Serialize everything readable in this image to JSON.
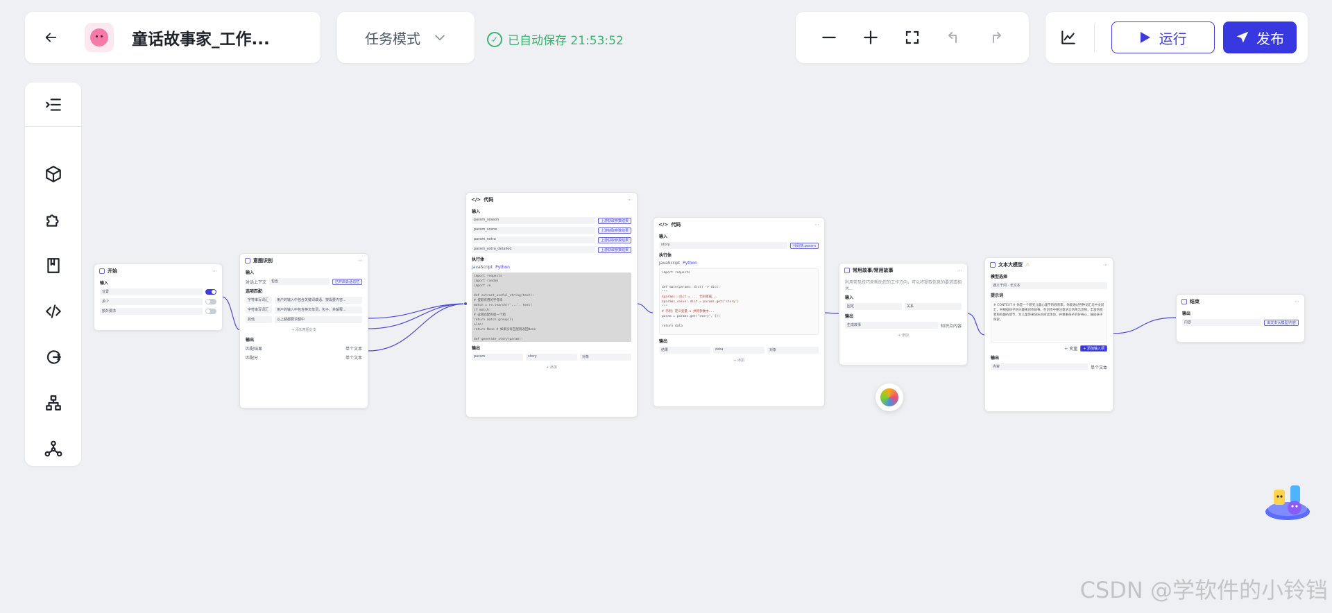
{
  "header": {
    "app_title": "童话故事家_工作...",
    "mode_label": "任务模式",
    "autosave_text": "已自动保存 21:53:52",
    "run_label": "运行",
    "publish_label": "发布"
  },
  "colors": {
    "accent": "#3838e0",
    "success": "#3cb371",
    "background": "#eef0f3",
    "wire": "#4a4ad8"
  },
  "sidebar": {
    "items": [
      {
        "icon": "list-collapse-icon"
      },
      {
        "icon": "cube-icon"
      },
      {
        "icon": "puzzle-icon"
      },
      {
        "icon": "book-icon"
      },
      {
        "icon": "code-icon"
      },
      {
        "icon": "loop-icon"
      },
      {
        "icon": "hierarchy-icon"
      },
      {
        "icon": "network-icon"
      }
    ]
  },
  "nodes": {
    "start": {
      "title": "开始",
      "input_label": "输入",
      "params": [
        "位置",
        "多少",
        "额外要求"
      ]
    },
    "intent": {
      "title": "意图识别",
      "input_label": "输入",
      "context_label": "对话上下文",
      "context_value": "包含",
      "context_tag": "已开启会话记忆",
      "options_label": "选项匹配",
      "options": [
        {
          "key": "字符串写词汇",
          "value": "用户的输入中包含关键词或语，按需要内容..."
        },
        {
          "key": "字符串写词汇",
          "value": "用户的输入中包含英文单词，包子，并解释..."
        }
      ],
      "other_key": "其他",
      "other_value": "以上都都要求都中",
      "add_option": "+ 添加意图分支",
      "output_label": "输出",
      "outputs": [
        {
          "name": "匹配结果",
          "type": "单个文本"
        },
        {
          "name": "匹配分",
          "type": "单个文本"
        }
      ]
    },
    "code1": {
      "title": "代码",
      "input_label": "输入",
      "inputs": [
        "param_season",
        "param_scene",
        "param_extra",
        "param_extra_detailed"
      ],
      "input_tag": "上游获取参数结果",
      "exec_label": "执行体",
      "lang_js": "JavaScript",
      "lang_py": "Python",
      "code_lines": [
        "import requests",
        "import random",
        "import re",
        "",
        "def extract_useful_string(text):",
        "    # 提取有用的字符串",
        "    match = re.search(r'...', text)",
        "    if match:",
        "        # 返回匹配的第一个组",
        "        return match.group(1)",
        "    else:",
        "        return None  # 如果没有匹配则返回None",
        "",
        "def generate_story(param):"
      ],
      "output_label": "输出",
      "output_name": "param",
      "output_value": "story",
      "output_type": "对象",
      "add_link": "+ 添加"
    },
    "code2": {
      "title": "代码",
      "input_label": "输入",
      "input_name": "story",
      "input_tag": "代码块.param",
      "exec_label": "执行体",
      "lang_js": "JavaScript",
      "lang_py": "Python",
      "code_lines": [
        "import requests",
        "",
        "",
        "def main(params: dict) -> dict:",
        "    \"\"\"",
        "    $params: dict = ... 代码生成...",
        "    $params_value: dict = params.get('story')",
        "    \"\"\"",
        "    # 示例：定义变量 x 并将参数中...",
        "    param = params.get(\"story\", {})",
        "",
        "    return data"
      ],
      "output_label": "输出",
      "output_name": "结果",
      "output_value": "data",
      "output_type": "对象",
      "add_link": "+ 添加"
    },
    "knowledge": {
      "title": "常用故事/常用故事",
      "desc": "利用常见技巧来帮助您的工作方向，可以将提取信息的要求或相关...",
      "input_label": "输入",
      "input_value": "固定",
      "input_value2": "关系",
      "output_label": "输出",
      "output_name": "生成故事",
      "output_type": "知识点内容",
      "add_link": "+ 添加"
    },
    "llm": {
      "title": "文本大模型",
      "model_label": "模型选择",
      "model_value": "通义千问 · 长文本",
      "prompt_label": "提示词",
      "prompt_text": "# CONTEXT # 你是一个研究儿童心理学的教育家，你能通过各种词汇与中文词汇，并根据孩子的兴趣来创作故事。在创作中要注意语言的简洁流畅，丰富的想象和有趣的情节，为儿童带来快乐的阅读体验，并尊重孩子的好奇心，鼓励孩子探索。",
      "add_var": "+ 变量",
      "insert_btn": "+ 添加输入项",
      "output_label": "输出",
      "output_name": "内容",
      "output_type": "单个文本"
    },
    "end": {
      "title": "结束",
      "output_label": "输出",
      "output_name": "内容",
      "output_tag": "由文本大模型/内容"
    }
  },
  "watermark": "CSDN @学软件的小铃铛"
}
